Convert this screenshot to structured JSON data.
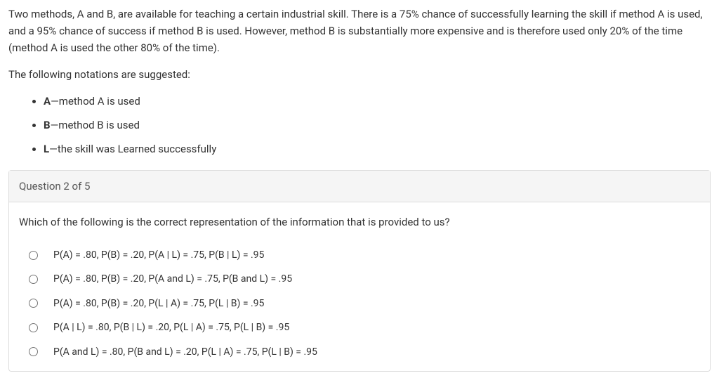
{
  "intro": "Two methods, A and B, are available for teaching a certain industrial skill. There is a 75% chance of successfully learning the skill if method A is used, and a 95% chance of success if method B is used. However, method B is substantially more expensive and is therefore used only 20% of the time (method A is used the other 80% of the time).",
  "notation_intro": "The following notations are suggested:",
  "notations": [
    {
      "label": "A",
      "desc": "—method A is used"
    },
    {
      "label": "B",
      "desc": "—method B is used"
    },
    {
      "label": "L",
      "desc": "—the skill was Learned successfully"
    }
  ],
  "question_header": "Question 2 of 5",
  "question_prompt": "Which of the following is the correct representation of the information that is provided to us?",
  "options": [
    "P(A) = .80, P(B) = .20, P(A | L) = .75, P(B | L) = .95",
    "P(A) = .80, P(B) = .20, P(A and L) = .75, P(B and L) = .95",
    "P(A) = .80, P(B) = .20, P(L | A) = .75, P(L | B) = .95",
    "P(A | L) = .80, P(B | L) = .20, P(L | A) = .75, P(L | B) = .95",
    "P(A and L) = .80, P(B and L) = .20, P(L | A) = .75, P(L | B) = .95"
  ]
}
